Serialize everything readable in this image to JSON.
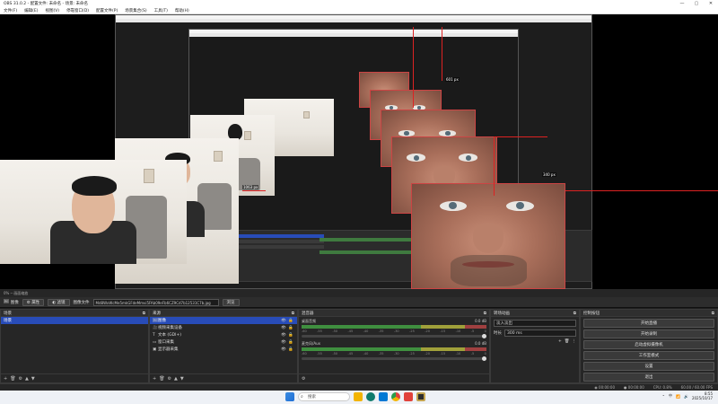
{
  "window": {
    "title": "OBS 31.0.2 - 配置文件: 未命名 - 场景: 未命名",
    "controls": [
      "—",
      "▢",
      "✕"
    ]
  },
  "menu": [
    "文件(F)",
    "编辑(E)",
    "视图(V)",
    "停靠窗口(D)",
    "配置文件(P)",
    "场景集合(S)",
    "工具(T)",
    "帮助(H)"
  ],
  "preview": {
    "measure_labels": [
      "601 px",
      "1063 px",
      "340 px"
    ],
    "status": "0% ─ 画面缩放"
  },
  "source_toolbar": {
    "source_label": "图像",
    "properties_button": "属性",
    "filters_button": "滤镜",
    "image_file_label": "图像文件",
    "image_file_value": "Md8WxWcMe5mkGFdeMmvi5FAb09eFb6CZ9Cd7b12531C7b.jpg",
    "browse_button": "浏览"
  },
  "scenes": {
    "title": "场景",
    "items": [
      "场景"
    ],
    "footer_icons": [
      "+",
      "🗑",
      "⚙",
      "▲",
      "▼"
    ]
  },
  "sources": {
    "title": "来源",
    "items": [
      {
        "icon": "🖼",
        "name": "图像",
        "selected": true
      },
      {
        "icon": "🎥",
        "name": "视频采集设备",
        "selected": false
      },
      {
        "icon": "T",
        "name": "文本 (GDI+)",
        "selected": false
      },
      {
        "icon": "▭",
        "name": "窗口采集",
        "selected": false
      },
      {
        "icon": "▣",
        "name": "显示器采集",
        "selected": false
      }
    ],
    "footer_icons": [
      "+",
      "🗑",
      "⚙",
      "▲",
      "▼"
    ]
  },
  "mixer": {
    "title": "混音器",
    "tracks": [
      {
        "name": "桌面音频",
        "db": "0.0 dB"
      },
      {
        "name": "麦克风/Aux",
        "db": "0.0 dB"
      }
    ],
    "scale": [
      "-60",
      "-55",
      "-50",
      "-45",
      "-40",
      "-35",
      "-30",
      "-25",
      "-20",
      "-15",
      "-10",
      "-5",
      "0"
    ]
  },
  "transitions": {
    "title": "转场动画",
    "selected": "淡入淡出",
    "duration_label": "时长",
    "duration_value": "300 ms"
  },
  "controls": {
    "title": "控制按钮",
    "buttons": [
      "开始直播",
      "开始录制",
      "启动虚拟摄像机",
      "工作室模式",
      "设置",
      "退出"
    ]
  },
  "obs_status": {
    "live": "00:00:00",
    "rec": "00:00:00",
    "cpu": "CPU: 0.8%",
    "fps": "60.00 / 60.00 FPS"
  },
  "taskbar": {
    "search_placeholder": "搜索",
    "time": "8:55",
    "date": "2025/10/17",
    "ime": "中",
    "icon_colors": [
      "#1f6fd6",
      "#f3b400",
      "#0f7b6c",
      "#0078d4",
      "#e1423b",
      "#c3a34d"
    ]
  },
  "colors": {
    "selection": "#284cb8",
    "accent_red": "#dd2222"
  }
}
